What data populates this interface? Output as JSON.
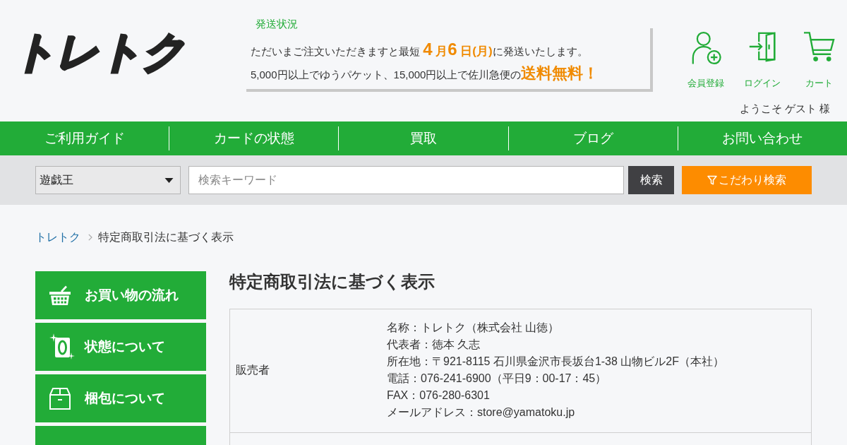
{
  "header": {
    "logo": "トレトク",
    "shipping": {
      "title": "発送状況",
      "lines": [
        [
          {
            "text": "ただいまご注文いただきますと最短 ",
            "kind": "plain"
          },
          {
            "text": "4",
            "kind": "number"
          },
          {
            "text": " 月",
            "kind": "accent"
          },
          {
            "text": "6",
            "kind": "number"
          },
          {
            "text": " 日(月)",
            "kind": "accent"
          },
          {
            "text": "に発送いたします。",
            "kind": "plain"
          }
        ],
        [
          {
            "text": "5,000円以上でゆうパケット、15,000円以上で佐川急便の",
            "kind": "plain"
          },
          {
            "text": "送料無料！",
            "kind": "highlight"
          }
        ]
      ]
    },
    "account_links": [
      {
        "label": "会員登録",
        "kind": "register"
      },
      {
        "label": "ログイン",
        "kind": "login"
      },
      {
        "label": "カート",
        "kind": "cart"
      }
    ],
    "welcome": "ようこそ ゲスト 様"
  },
  "nav": [
    "ご利用ガイド",
    "カードの状態",
    "買取",
    "ブログ",
    "お問い合わせ"
  ],
  "search": {
    "category": "遊戯王",
    "placeholder": "検索キーワード",
    "button": "検索",
    "filter_button": "こだわり検索"
  },
  "breadcrumb": [
    "トレトク",
    "特定商取引法に基づく表示"
  ],
  "sidebar": [
    {
      "label": "お買い物の流れ",
      "kind": "basket"
    },
    {
      "label": "状態について",
      "kind": "card"
    },
    {
      "label": "梱包について",
      "kind": "box"
    },
    {
      "kind": "cut"
    }
  ],
  "page_title": "特定商取引法に基づく表示",
  "table": {
    "rows": [
      {
        "label": "販売者",
        "lines": [
          "名称：トレトク（株式会社 山徳）",
          "代表者：徳本 久志",
          "所在地：〒921-8115 石川県金沢市長坂台1-38 山物ビル2F（本社）",
          "電話：076-241-6900（平日9：00-17：45）",
          "FAX：076-280-6301",
          "メールアドレス：store@yamatoku.jp"
        ]
      }
    ]
  }
}
